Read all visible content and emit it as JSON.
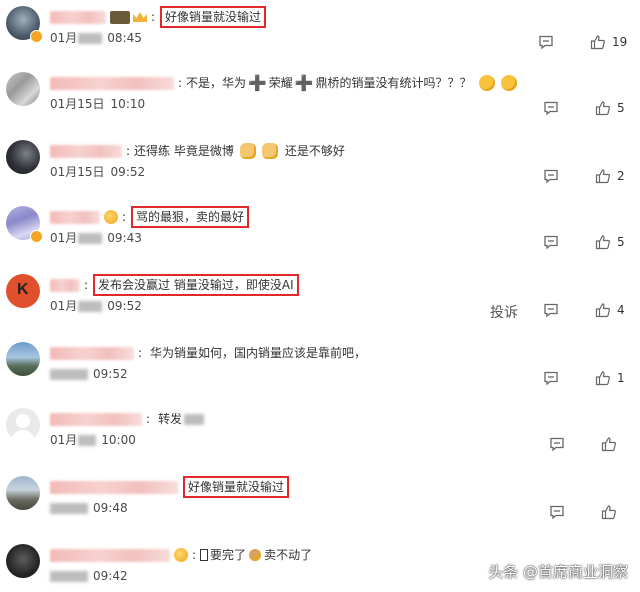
{
  "comments": [
    {
      "prefix": "",
      "text": "好像销量就没输过",
      "highlighted": true,
      "date_prefix": "01月",
      "date_blurred": true,
      "time": "08:45",
      "likes": "19"
    },
    {
      "prefix": "不是，华为",
      "seg2": "荣耀",
      "seg3": "鼎桥的销量没有统计吗？？？",
      "plus_symbol": "➕",
      "highlighted": false,
      "date": "01月15日",
      "time": "10:10",
      "likes": "5"
    },
    {
      "text": "还得练 毕竟是微博",
      "text_after": "还是不够好",
      "highlighted": false,
      "date": "01月15日",
      "time": "09:52",
      "likes": "2"
    },
    {
      "text": "骂的最狠，卖的最好",
      "highlighted": true,
      "date_prefix": "01月",
      "time": "09:43",
      "likes": "5"
    },
    {
      "text": "发布会没赢过 销量没输过，即使没AI",
      "highlighted": true,
      "date_prefix": "01月",
      "time": "09:52",
      "likes": "4",
      "report_label": "投诉"
    },
    {
      "text": "华为销量如何，国内销量应该是靠前吧，",
      "highlighted": false,
      "time": "09:52",
      "likes": "1"
    },
    {
      "text": "转发",
      "highlighted": false,
      "date_prefix": "01月",
      "time": "10:00",
      "likes": ""
    },
    {
      "text": "好像销量就没输过",
      "highlighted": true,
      "time": "09:48",
      "likes": ""
    },
    {
      "text_a": "要完了",
      "text_b": "卖不动了",
      "highlighted": false,
      "time": "09:42",
      "likes": ""
    }
  ],
  "watermark": "头条 @首席商业洞察",
  "colors": {
    "highlight_border": "#e0282d",
    "plus_purple": "#7e3fc0",
    "icon_gray": "#666666"
  },
  "icons": {
    "reply": "comment-icon",
    "like": "thumbs-up-icon",
    "verified": "vip-badge-icon"
  }
}
